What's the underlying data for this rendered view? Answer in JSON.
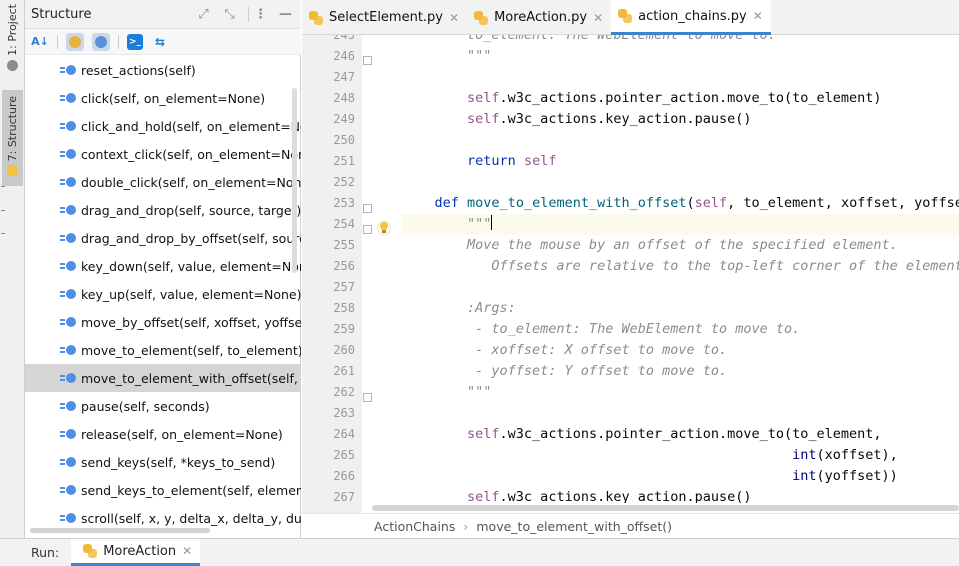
{
  "left_strip": {
    "project_tab": "1: Project",
    "structure_tab": "7: Structure"
  },
  "structure_panel": {
    "title": "Structure",
    "toolbar": [
      "sort-alpha",
      "show-inherited",
      "show-fields",
      "run-console",
      "autoscroll"
    ],
    "items": [
      {
        "label": "reset_actions(self)"
      },
      {
        "label": "click(self, on_element=None)"
      },
      {
        "label": "click_and_hold(self, on_element=None"
      },
      {
        "label": "context_click(self, on_element=None)"
      },
      {
        "label": "double_click(self, on_element=None)"
      },
      {
        "label": "drag_and_drop(self, source, target)"
      },
      {
        "label": "drag_and_drop_by_offset(self, source,"
      },
      {
        "label": "key_down(self, value, element=None)"
      },
      {
        "label": "key_up(self, value, element=None)"
      },
      {
        "label": "move_by_offset(self, xoffset, yoffset)"
      },
      {
        "label": "move_to_element(self, to_element)"
      },
      {
        "label": "move_to_element_with_offset(self, to_e",
        "selected": true
      },
      {
        "label": "pause(self, seconds)"
      },
      {
        "label": "release(self, on_element=None)"
      },
      {
        "label": "send_keys(self, *keys_to_send)"
      },
      {
        "label": "send_keys_to_element(self, element, *k"
      },
      {
        "label": "scroll(self, x, y, delta_x, delta_y, duratio"
      }
    ]
  },
  "editor": {
    "tabs": [
      {
        "label": "SelectElement.py",
        "active": false
      },
      {
        "label": "MoreAction.py",
        "active": false
      },
      {
        "label": "action_chains.py",
        "active": true
      }
    ],
    "top_partial_line": "    to_element: The WebElement to move to.",
    "lines": [
      {
        "num": "245",
        "text": "        to_element: The WebElement to move to."
      },
      {
        "num": "246",
        "text": "        \"\"\""
      },
      {
        "num": "247",
        "text": ""
      },
      {
        "num": "248",
        "text": "        self.w3c_actions.pointer_action.move_to(to_element)"
      },
      {
        "num": "249",
        "text": "        self.w3c_actions.key_action.pause()"
      },
      {
        "num": "250",
        "text": ""
      },
      {
        "num": "251",
        "text": "        return self"
      },
      {
        "num": "252",
        "text": ""
      },
      {
        "num": "253",
        "text": "    def move_to_element_with_offset(self, to_element, xoffset, yoffset):"
      },
      {
        "num": "254",
        "text": "        \"\"\""
      },
      {
        "num": "255",
        "text": "        Move the mouse by an offset of the specified element."
      },
      {
        "num": "256",
        "text": "           Offsets are relative to the top-left corner of the element."
      },
      {
        "num": "257",
        "text": ""
      },
      {
        "num": "258",
        "text": "        :Args:"
      },
      {
        "num": "259",
        "text": "         - to_element: The WebElement to move to."
      },
      {
        "num": "260",
        "text": "         - xoffset: X offset to move to."
      },
      {
        "num": "261",
        "text": "         - yoffset: Y offset to move to."
      },
      {
        "num": "262",
        "text": "        \"\"\""
      },
      {
        "num": "263",
        "text": ""
      },
      {
        "num": "264",
        "text": "        self.w3c_actions.pointer_action.move_to(to_element,"
      },
      {
        "num": "265",
        "text": "                                                int(xoffset),"
      },
      {
        "num": "266",
        "text": "                                                int(yoffset))"
      },
      {
        "num": "267",
        "text": "        self.w3c_actions.key_action.pause()"
      }
    ],
    "current_line": "254",
    "breadcrumb": [
      "ActionChains",
      "move_to_element_with_offset()"
    ]
  },
  "run_bar": {
    "label": "Run:",
    "tab": "MoreAction"
  },
  "colors": {
    "keyword": "#0033b3",
    "self": "#94558d",
    "docstring": "#8c8c8c",
    "active_tab_underline": "#4083c9",
    "method_icon": "#4f8ee8"
  }
}
